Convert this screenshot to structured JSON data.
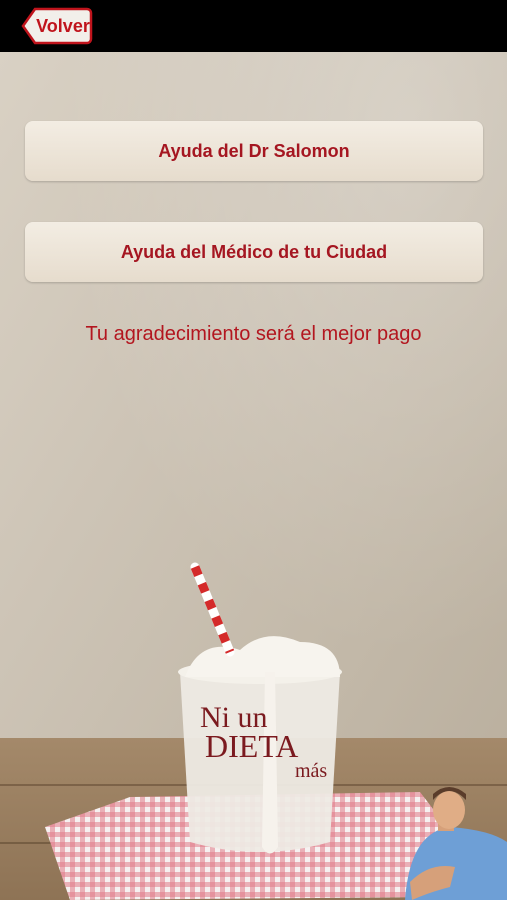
{
  "topbar": {
    "back_label": "Volver"
  },
  "menu": {
    "button1_label": "Ayuda del Dr Salomon",
    "button2_label": "Ayuda del Médico de tu Ciudad"
  },
  "tagline": "Tu agradecimiento será el mejor pago",
  "illustration": {
    "glass_text_line1": "Ni un",
    "glass_text_line2": "DIETA",
    "glass_text_line3": "más"
  },
  "colors": {
    "accent": "#b3161f",
    "topbar": "#000000",
    "button_bg": "#efe7db"
  }
}
